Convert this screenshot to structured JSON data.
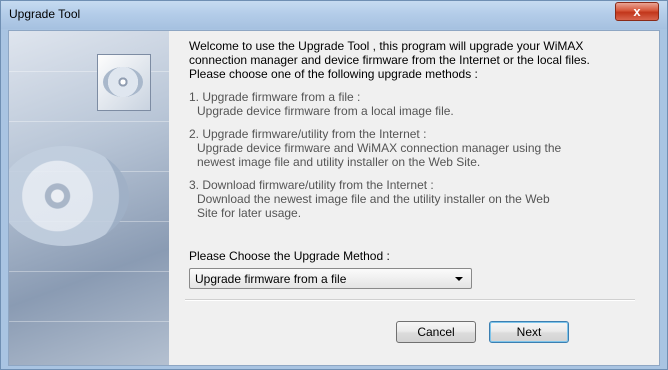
{
  "window": {
    "title": "Upgrade Tool",
    "close_label": "x"
  },
  "intro": {
    "line1": "Welcome to use the Upgrade Tool , this program will upgrade your WiMAX",
    "line2": "connection manager and device firmware from the Internet or the local files.",
    "line3": "Please choose one of the following upgrade methods :"
  },
  "methods": [
    {
      "title": "1. Upgrade firmware from a file :",
      "desc": [
        "Upgrade device firmware from a local image file."
      ]
    },
    {
      "title": "2. Upgrade firmware/utility from the Internet :",
      "desc": [
        "Upgrade device firmware and WiMAX connection manager using the",
        "newest image file and utility installer on the Web Site."
      ]
    },
    {
      "title": "3. Download firmware/utility from the Internet :",
      "desc": [
        "Download the newest image file and the utility installer on the Web",
        "Site for later usage."
      ]
    }
  ],
  "choose": {
    "label": "Please Choose the Upgrade Method :",
    "selected": "Upgrade firmware from a file"
  },
  "buttons": {
    "cancel": "Cancel",
    "next": "Next"
  }
}
